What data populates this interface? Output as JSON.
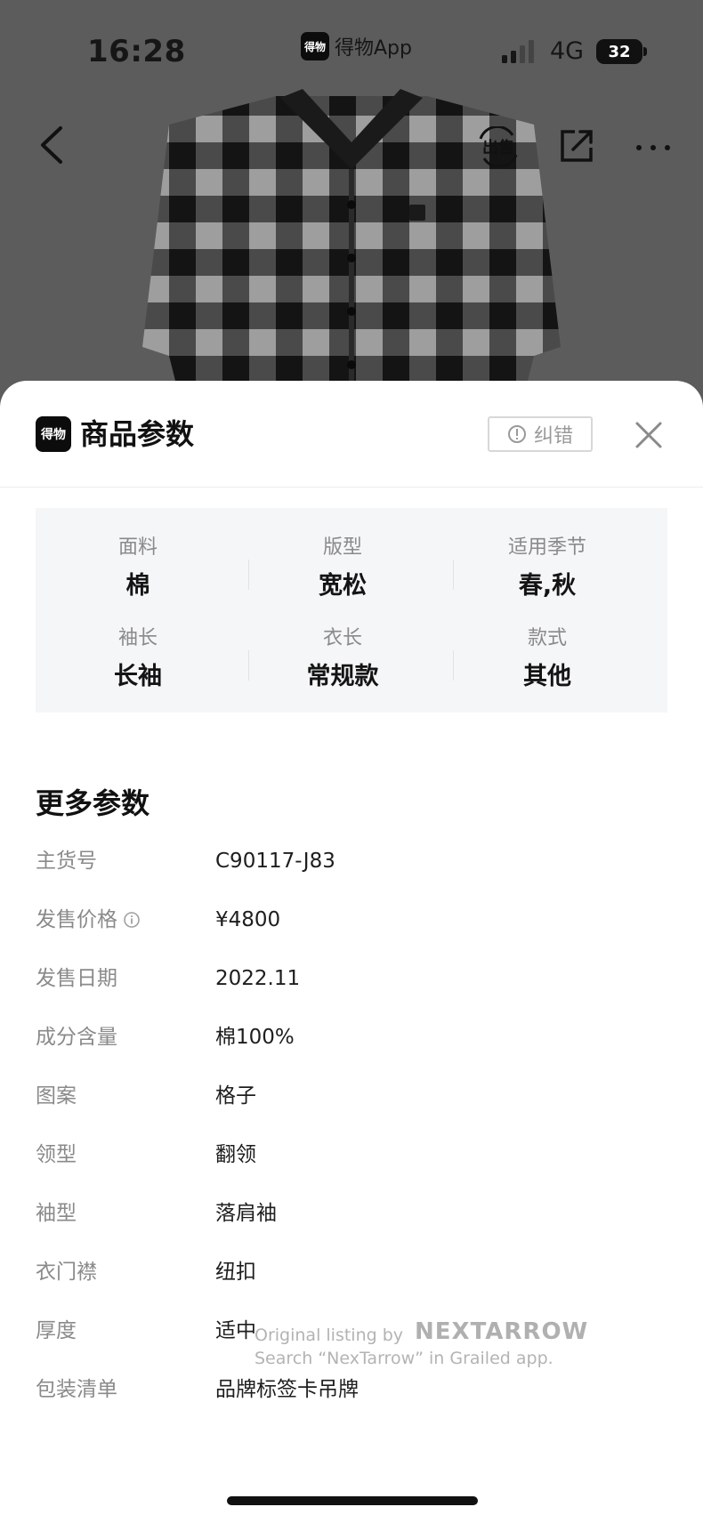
{
  "status_bar": {
    "time": "16:28",
    "app_badge_logo": "得物",
    "app_name": "得物App",
    "network": "4G",
    "battery": "32"
  },
  "nav": {
    "back_icon": "chevron-left-icon",
    "sell_label": "出售",
    "share_icon": "share-icon",
    "more_icon": "more-dots-icon"
  },
  "sheet": {
    "logo_text": "得物",
    "title": "商品参数",
    "report_label": "纠错",
    "close_icon": "close-icon"
  },
  "params": [
    {
      "label": "面料",
      "value": "棉"
    },
    {
      "label": "版型",
      "value": "宽松"
    },
    {
      "label": "适用季节",
      "value": "春,秋"
    },
    {
      "label": "袖长",
      "value": "长袖"
    },
    {
      "label": "衣长",
      "value": "常规款"
    },
    {
      "label": "款式",
      "value": "其他"
    }
  ],
  "more": {
    "title": "更多参数",
    "rows": [
      {
        "label": "主货号",
        "value": "C90117-J83"
      },
      {
        "label": "发售价格",
        "value": "¥4800"
      },
      {
        "label": "发售日期",
        "value": "2022.11"
      },
      {
        "label": "成分含量",
        "value": "棉100%"
      },
      {
        "label": "图案",
        "value": "格子"
      },
      {
        "label": "领型",
        "value": "翻领"
      },
      {
        "label": "袖型",
        "value": "落肩袖"
      },
      {
        "label": "衣门襟",
        "value": "纽扣"
      },
      {
        "label": "厚度",
        "value": "适中"
      },
      {
        "label": "包装清单",
        "value": "品牌标签卡吊牌"
      }
    ]
  },
  "watermark": {
    "line1": "Original listing by",
    "brand": "NEXTARROW",
    "line2": "Search “NexTarrow” in Grailed app."
  },
  "colors": {
    "sheet_bg": "#ffffff",
    "card_bg": "#f5f6f8",
    "label_gray": "#8a8a8a",
    "overlay": "#5c5c5c"
  }
}
